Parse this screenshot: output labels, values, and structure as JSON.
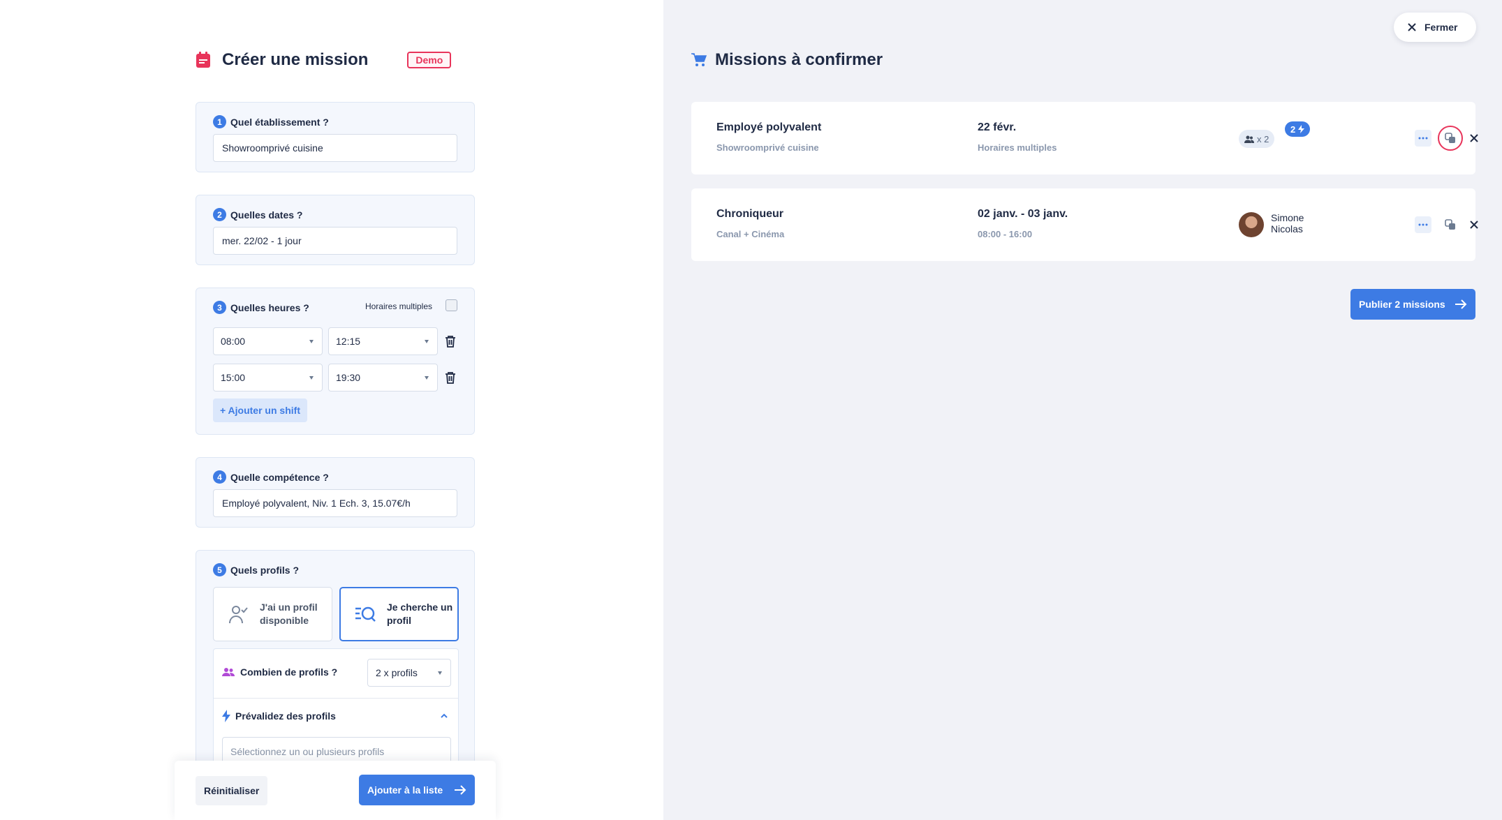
{
  "left": {
    "title": "Créer une mission",
    "badge": "Demo",
    "step1": {
      "num": "1",
      "label": "Quel établissement ?",
      "value": "Showroomprivé cuisine"
    },
    "step2": {
      "num": "2",
      "label": "Quelles dates ?",
      "value": "mer. 22/02 - 1 jour"
    },
    "step3": {
      "num": "3",
      "label": "Quelles heures ?",
      "multi_label": "Horaires multiples",
      "shifts": [
        {
          "start": "08:00",
          "end": "12:15"
        },
        {
          "start": "15:00",
          "end": "19:30"
        }
      ],
      "add_shift": "+ Ajouter un shift"
    },
    "step4": {
      "num": "4",
      "label": "Quelle compétence ?",
      "value": "Employé polyvalent, Niv. 1 Ech. 3, 15.07€/h"
    },
    "step5": {
      "num": "5",
      "label": "Quels profils ?",
      "option_a": "J'ai un profil disponible",
      "option_b": "Je cherche un profil",
      "count_label": "Combien de profils ?",
      "count_value": "2 x profils",
      "prevalidate_label": "Prévalidez des profils",
      "search_placeholder": "Sélectionnez un ou plusieurs profils"
    },
    "footer": {
      "reset": "Réinitialiser",
      "add": "Ajouter à la liste"
    }
  },
  "right": {
    "close": "Fermer",
    "title": "Missions à confirmer",
    "missions": [
      {
        "title": "Employé polyvalent",
        "place": "Showroomprivé cuisine",
        "date": "22 févr.",
        "time": "Horaires multiples",
        "count": "x 2",
        "flash": "2"
      },
      {
        "title": "Chroniqueur",
        "place": "Canal + Cinéma",
        "date": "02 janv. - 03 janv.",
        "time": "08:00 - 16:00",
        "person": "Simone Nicolas"
      }
    ],
    "publish": "Publier 2 missions"
  },
  "colors": {
    "accent": "#3d7be4",
    "demo": "#e8345a",
    "panel_bg": "#f1f2f7"
  }
}
